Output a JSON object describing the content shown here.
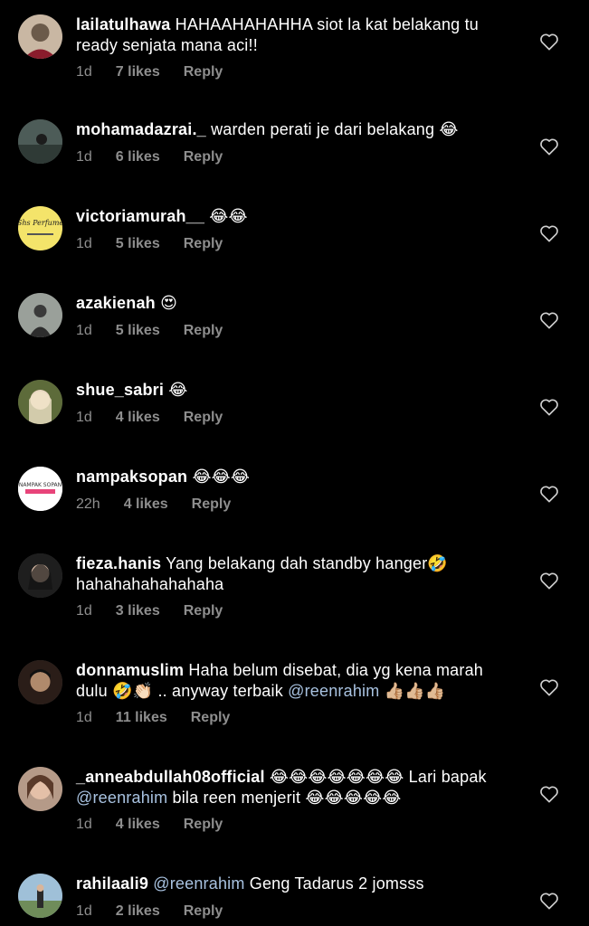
{
  "comments": [
    {
      "username": "lailatulhawa",
      "text": "HAHAAHAHAHHA siot la kat belakang tu ready senjata mana aci!!",
      "time": "1d",
      "likes": "7 likes",
      "reply": "Reply",
      "avatar_color": "#6b5a4a"
    },
    {
      "username": "mohamadazrai._",
      "text": "warden perati je dari belakang 😂",
      "time": "1d",
      "likes": "6 likes",
      "reply": "Reply",
      "avatar_color": "#3d4a44"
    },
    {
      "username": "victoriamurah__",
      "text": "😂😂",
      "time": "1d",
      "likes": "5 likes",
      "reply": "Reply",
      "avatar_color": "#f4e46a"
    },
    {
      "username": "azakienah",
      "text": "😍",
      "time": "1d",
      "likes": "5 likes",
      "reply": "Reply",
      "avatar_color": "#8a8f86"
    },
    {
      "username": "shue_sabri",
      "text": "😂",
      "time": "1d",
      "likes": "4 likes",
      "reply": "Reply",
      "avatar_color": "#5c6a3c"
    },
    {
      "username": "nampaksopan",
      "text": "😂😂😂",
      "time": "22h",
      "likes": "4 likes",
      "reply": "Reply",
      "avatar_color": "#ffffff"
    },
    {
      "username": "fieza.hanis",
      "text": "Yang belakang dah standby hanger🤣 hahahahahahahaha",
      "time": "1d",
      "likes": "3 likes",
      "reply": "Reply",
      "avatar_color": "#2a2a2a"
    },
    {
      "username": "donnamuslim",
      "text_parts": [
        "Haha belum disebat, dia yg kena marah dulu 🤣👏🏻 .. anyway terbaik ",
        "@reenrahim",
        " 👍🏼👍🏼👍🏼"
      ],
      "time": "1d",
      "likes": "11 likes",
      "reply": "Reply",
      "avatar_color": "#3a2a24"
    },
    {
      "username": "_anneabdullah08official",
      "text_parts": [
        "😂😂😂😂😂😂😂 Lari bapak ",
        "@reenrahim",
        "  bila reen menjerit 😂😂😂😂😂"
      ],
      "time": "1d",
      "likes": "4 likes",
      "reply": "Reply",
      "avatar_color": "#a07862"
    },
    {
      "username": "rahilaali9",
      "text_parts": [
        "",
        "@reenrahim",
        "  Geng Tadarus 2 jomsss"
      ],
      "time": "1d",
      "likes": "2 likes",
      "reply": "Reply",
      "avatar_color": "#6f8c9c"
    }
  ],
  "avatar_labels": {
    "victoriamurah": "Shs Perfume",
    "nampaksopan": "NAMPAK SOPAN"
  }
}
